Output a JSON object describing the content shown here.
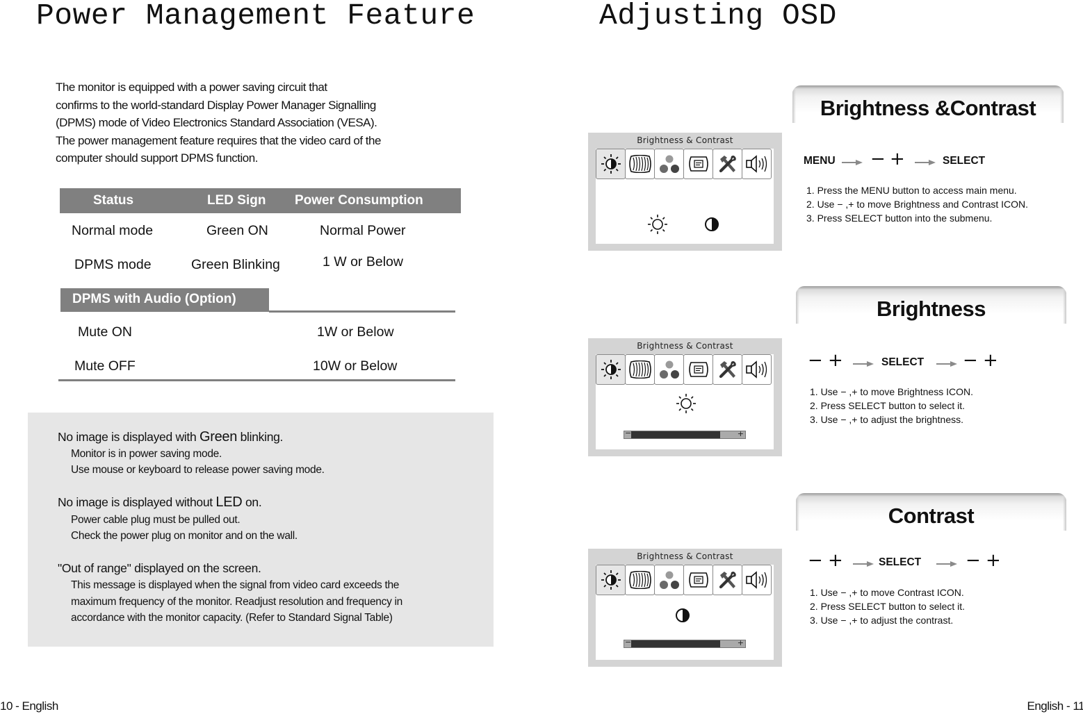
{
  "left_page": {
    "title": "Power Management Feature",
    "intro_lines": [
      "The monitor is equipped with a power saving circuit that",
      "confirms to the world-standard Display Power Manager Signalling",
      "(DPMS) mode of Video Electronics Standard Association (VESA).",
      "The power management feature requires that the video card of the",
      "computer should support DPMS function."
    ],
    "table": {
      "headers": [
        "Status",
        "LED Sign",
        "Power Consumption"
      ],
      "rows": [
        [
          "Normal mode",
          "Green ON",
          "Normal Power"
        ],
        [
          "DPMS mode",
          "Green Blinking",
          "1 W or Below"
        ]
      ],
      "audio_header": "DPMS with Audio (Option)",
      "audio_rows": [
        [
          "Mute ON",
          "1W or Below"
        ],
        [
          "Mute OFF",
          "10W or Below"
        ]
      ]
    },
    "notes": [
      {
        "heading_pre": "No image is displayed with ",
        "heading_emph": "Green",
        "heading_post": " blinking.",
        "lines": [
          "Monitor is in power saving mode.",
          "Use mouse or keyboard to release power saving mode."
        ]
      },
      {
        "heading_pre": "No image is displayed without ",
        "heading_emph": "LED",
        "heading_post": " on.",
        "lines": [
          "Power cable plug must be pulled out.",
          "Check the power plug on monitor and on the wall."
        ]
      },
      {
        "heading_pre": "\"Out of range\" displayed on the screen.",
        "heading_emph": "",
        "heading_post": "",
        "lines": [
          "This message is displayed when the signal from video card exceeds the",
          "maximum frequency of the monitor. Readjust resolution and frequency in",
          "accordance with the monitor capacity. (Refer to Standard Signal Table)"
        ]
      }
    ],
    "footer": "10 - English"
  },
  "right_page": {
    "title": "Adjusting OSD",
    "osd_title": "Brightness & Contrast",
    "osd_tab_icons": [
      "brightness-contrast-icon",
      "geometry-icon",
      "color-icon",
      "osd-position-icon",
      "setup-tools-icon",
      "audio-icon"
    ],
    "sections": [
      {
        "header": "Brightness &Contrast",
        "flow": {
          "start": "MENU",
          "minus": "−",
          "plus": "+",
          "select": "SELECT"
        },
        "steps": [
          "1. Press the MENU button to access main menu.",
          "2. Use  − ,+ to move Brightness and Contrast ICON.",
          "3. Press SELECT button into the submenu."
        ]
      },
      {
        "header": "Brightness",
        "flow": {
          "minus": "−",
          "plus": "+",
          "select": "SELECT"
        },
        "slider_value_pct": 78,
        "steps": [
          "1. Use  − ,+ to move Brightness ICON.",
          "2. Press SELECT button to select it.",
          "3. Use  − ,+ to adjust the brightness."
        ]
      },
      {
        "header": "Contrast",
        "flow": {
          "minus": "−",
          "plus": "+",
          "select": "SELECT"
        },
        "slider_value_pct": 78,
        "steps": [
          "1. Use  − ,+ to move Contrast ICON.",
          "2. Press SELECT button to select it.",
          "3. Use  − ,+ to adjust the contrast."
        ]
      }
    ],
    "slider_labels": {
      "minus": "−",
      "plus": "+"
    },
    "footer": "English - 11"
  },
  "colors": {
    "table_header_bg": "#808080",
    "note_box_bg": "#e6e6e6",
    "osd_frame": "#d4d4d4",
    "slider_fill": "#333333",
    "arrow_gray": "#8a8a8a"
  }
}
